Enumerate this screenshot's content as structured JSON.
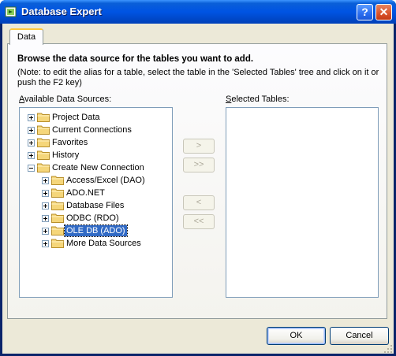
{
  "window": {
    "title": "Database Expert",
    "help_glyph": "?",
    "close_glyph": "✕"
  },
  "tab": {
    "label": "Data"
  },
  "heading": "Browse the data source for the tables you want to add.",
  "note": "(Note: to edit the alias for a table, select the table in the 'Selected Tables' tree and click on it or push the F2 key)",
  "available_label": "Available Data Sources:",
  "selected_label": "Selected Tables:",
  "tree": [
    {
      "label": "Project Data",
      "level": 0,
      "selected": false
    },
    {
      "label": "Current Connections",
      "level": 0,
      "selected": false
    },
    {
      "label": "Favorites",
      "level": 0,
      "selected": false
    },
    {
      "label": "History",
      "level": 0,
      "selected": false
    },
    {
      "label": "Create New Connection",
      "level": 0,
      "expanded": true,
      "selected": false
    },
    {
      "label": "Access/Excel (DAO)",
      "level": 1,
      "selected": false
    },
    {
      "label": "ADO.NET",
      "level": 1,
      "selected": false
    },
    {
      "label": "Database Files",
      "level": 1,
      "selected": false
    },
    {
      "label": "ODBC (RDO)",
      "level": 1,
      "selected": false
    },
    {
      "label": "OLE DB (ADO)",
      "level": 1,
      "selected": true
    },
    {
      "label": "More Data Sources",
      "level": 1,
      "selected": false
    }
  ],
  "transfer_buttons": {
    "add": ">",
    "add_all": ">>",
    "remove": "<",
    "remove_all": "<<"
  },
  "buttons": {
    "ok": "OK",
    "cancel": "Cancel"
  }
}
